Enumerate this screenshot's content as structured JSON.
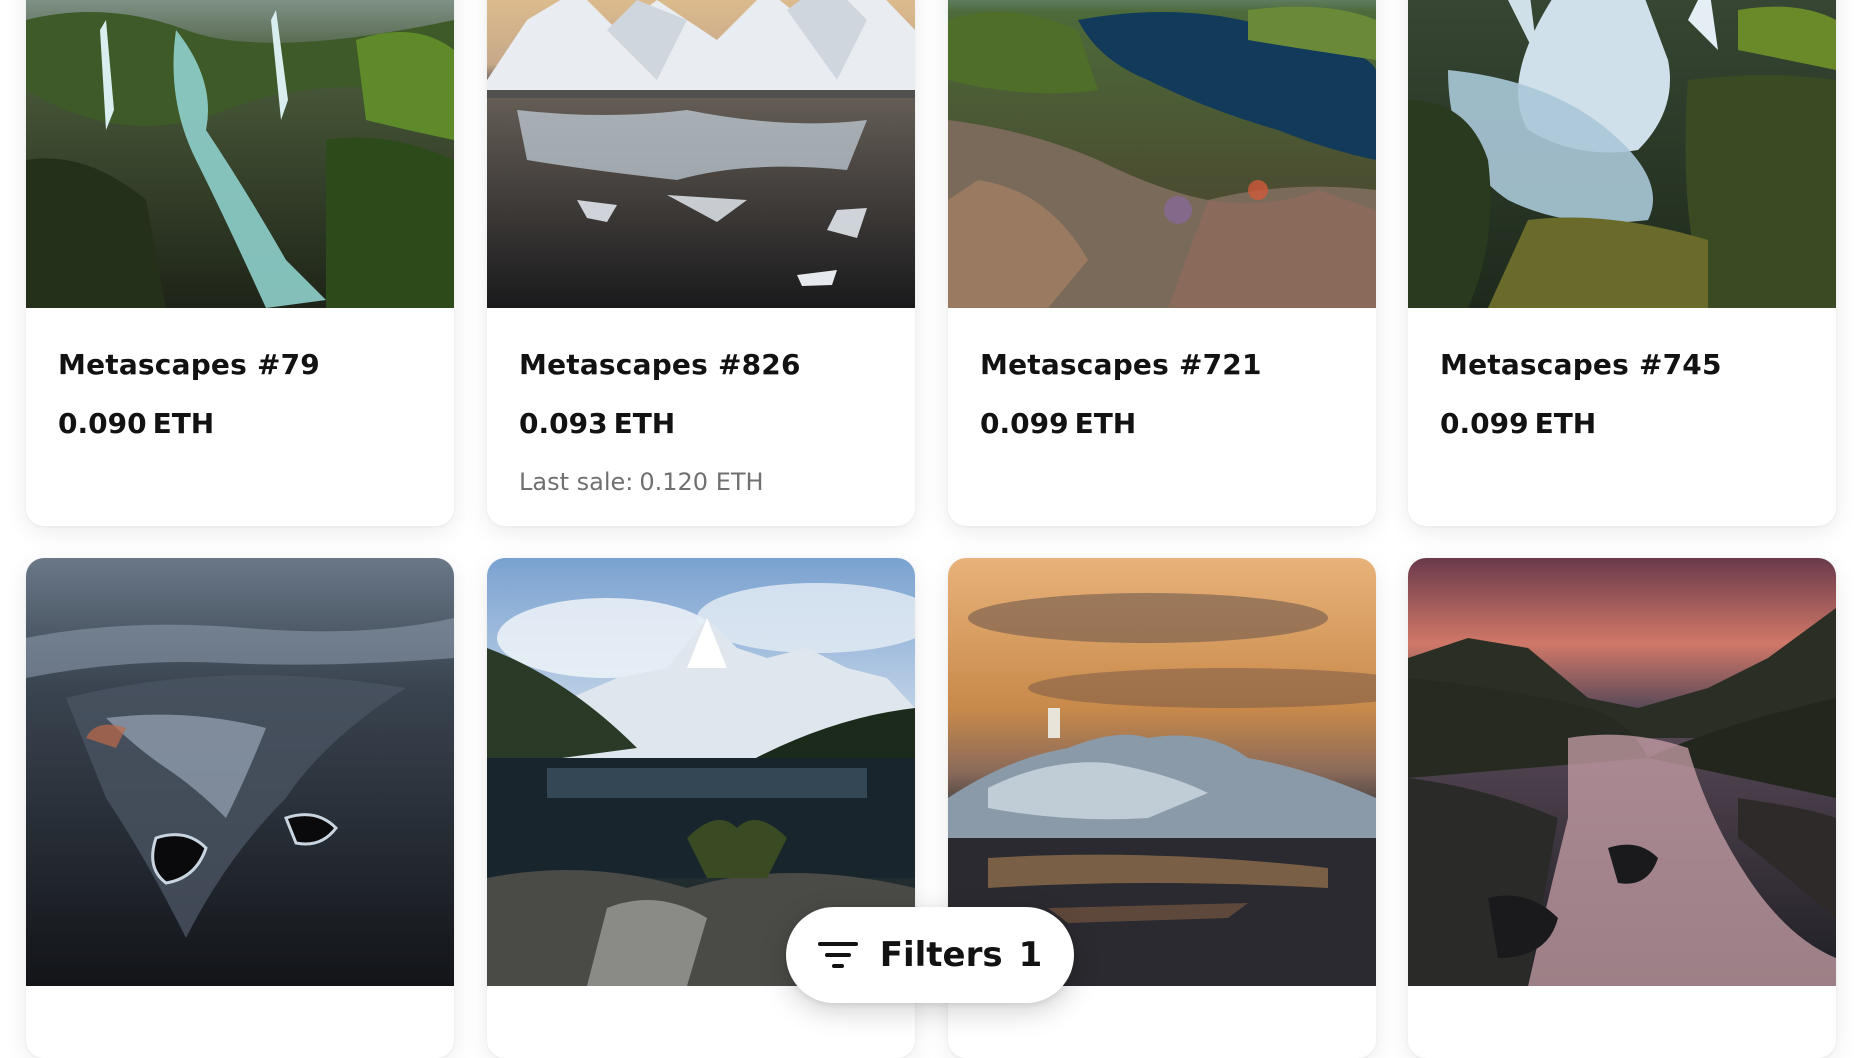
{
  "nft_grid": {
    "items": [
      {
        "title": "Metascapes #79",
        "price_value": "0.090",
        "price_unit": "ETH",
        "last_sale_label": "",
        "last_sale_value": ""
      },
      {
        "title": "Metascapes #826",
        "price_value": "0.093",
        "price_unit": "ETH",
        "last_sale_label": "Last sale:",
        "last_sale_value": "0.120 ETH"
      },
      {
        "title": "Metascapes #721",
        "price_value": "0.099",
        "price_unit": "ETH",
        "last_sale_label": "",
        "last_sale_value": ""
      },
      {
        "title": "Metascapes #745",
        "price_value": "0.099",
        "price_unit": "ETH",
        "last_sale_label": "",
        "last_sale_value": ""
      },
      {
        "title": "",
        "price_value": "",
        "price_unit": "",
        "last_sale_label": "",
        "last_sale_value": ""
      },
      {
        "title": "",
        "price_value": "",
        "price_unit": "",
        "last_sale_label": "",
        "last_sale_value": ""
      },
      {
        "title": "",
        "price_value": "",
        "price_unit": "",
        "last_sale_label": "",
        "last_sale_value": ""
      },
      {
        "title": "",
        "price_value": "",
        "price_unit": "",
        "last_sale_label": "",
        "last_sale_value": ""
      }
    ]
  },
  "filters_button": {
    "label": "Filters",
    "count": "1",
    "icon": "filter-icon"
  },
  "colors": {
    "text_primary": "#121212",
    "text_secondary": "#707070",
    "card_bg": "#ffffff"
  }
}
